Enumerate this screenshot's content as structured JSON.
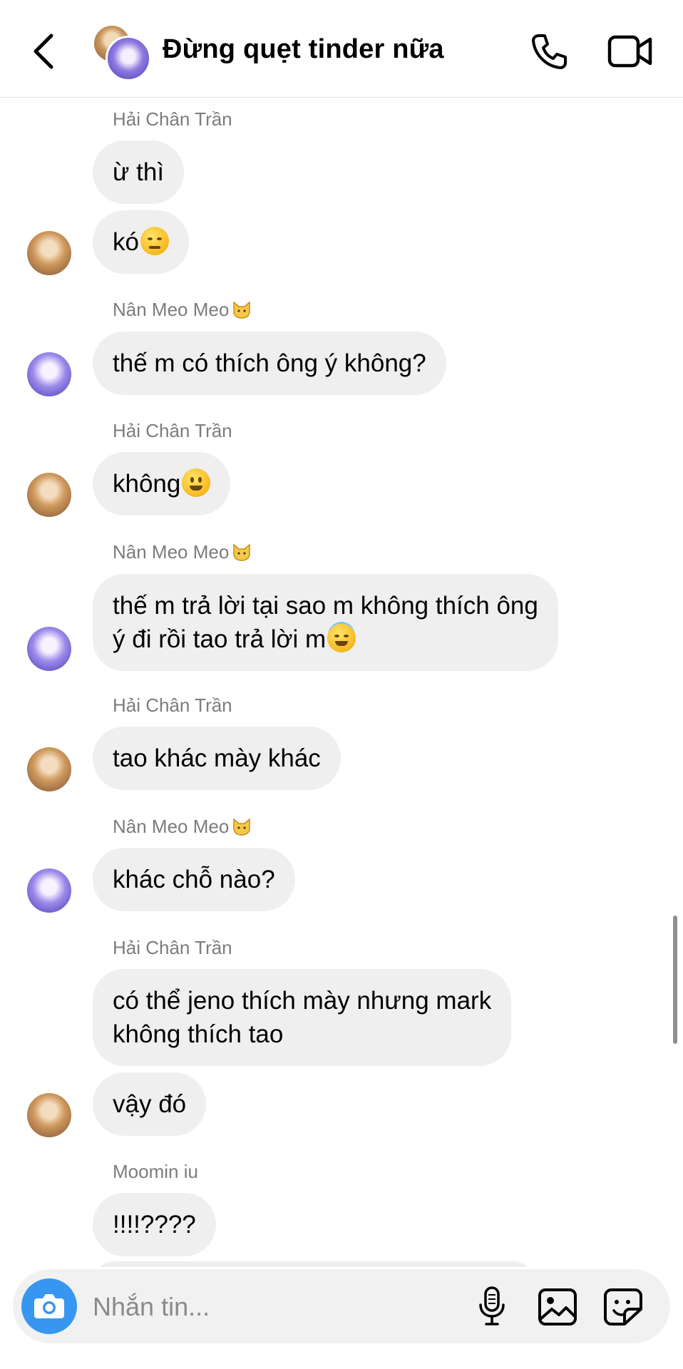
{
  "header": {
    "title": "Đừng quẹt tinder nữa"
  },
  "messages": [
    {
      "sender": "Hải Chân Trần",
      "bubbles": [
        "ừ thì",
        "kó"
      ]
    },
    {
      "sender": "Nân Meo Meo",
      "bubbles": [
        "thế m có thích ông ý không?"
      ]
    },
    {
      "sender": "Hải Chân Trần",
      "bubbles": [
        "không"
      ]
    },
    {
      "sender": "Nân Meo Meo",
      "bubbles": [
        "thế m trả lời tại sao m không thích ông",
        "ý đi rồi tao trả lời m"
      ]
    },
    {
      "sender": "Hải Chân Trần",
      "bubbles": [
        "tao khác mày khác"
      ]
    },
    {
      "sender": "Nân Meo Meo",
      "bubbles": [
        "khác chỗ nào?"
      ]
    },
    {
      "sender": "Hải Chân Trần",
      "bubbles": [
        "có thể jeno thích mày nhưng mark",
        "không thích tao",
        "vậy đó"
      ]
    },
    {
      "sender": "Moomin iu",
      "bubbles": [
        "!!!!????"
      ]
    }
  ],
  "composer": {
    "placeholder": "Nhắn tin..."
  },
  "colors": {
    "accent": "#3797f0",
    "bubble": "#efefef"
  },
  "icons": [
    "back-arrow-icon",
    "phone-icon",
    "video-camera-icon",
    "camera-icon",
    "microphone-icon",
    "gallery-icon",
    "sticker-icon",
    "cat-emoji",
    "disappointed-emoji",
    "smile-emoji",
    "halo-emoji"
  ]
}
